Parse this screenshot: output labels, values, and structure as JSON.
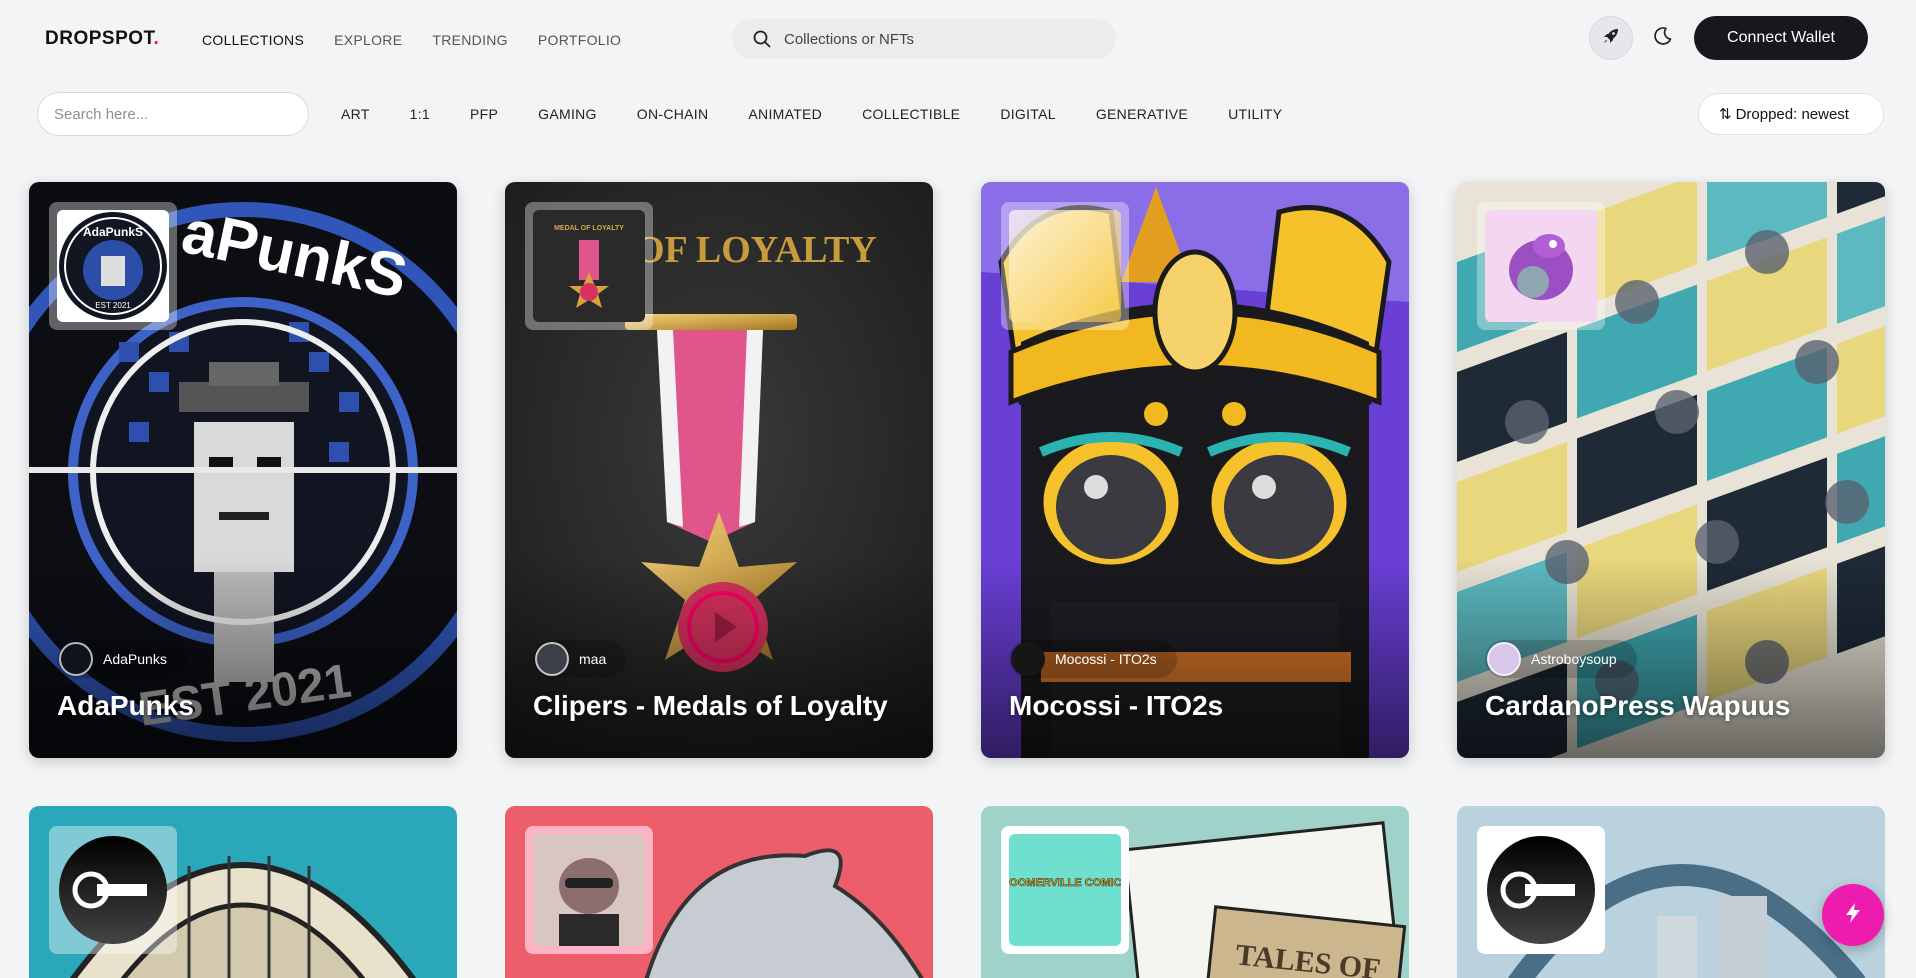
{
  "header": {
    "logo": "DROPSPOT",
    "logo_dot": ".",
    "nav": [
      "COLLECTIONS",
      "EXPLORE",
      "TRENDING",
      "PORTFOLIO"
    ],
    "search_placeholder": "Collections or NFTs",
    "connect_label": "Connect Wallet"
  },
  "filters": {
    "search_placeholder": "Search here...",
    "tags": [
      "ART",
      "1:1",
      "PFP",
      "GAMING",
      "ON-CHAIN",
      "ANIMATED",
      "COLLECTIBLE",
      "DIGITAL",
      "GENERATIVE",
      "UTILITY"
    ],
    "sort_label": "Dropped: newest"
  },
  "cards": [
    {
      "creator": "AdaPunks",
      "title": "AdaPunks",
      "thumb_text": "AdaPunkS",
      "thumb_sub": "EST 2021"
    },
    {
      "creator": "maa",
      "title": "Clipers - Medals of Loyalty",
      "thumb_text": "MEDAL OF LOYALTY",
      "banner_text": "OF LOYALTY"
    },
    {
      "creator": "Mocossi - ITO2s",
      "title": "Mocossi - ITO2s"
    },
    {
      "creator": "Astroboysoup",
      "title": "CardanoPress Wapuus"
    }
  ],
  "row2": [
    {
      "thumb": "key-logo"
    },
    {
      "thumb": "pig-avatar"
    },
    {
      "thumb_text": "BOOMERVILLE COMICS",
      "art_text": "TALES OF"
    },
    {
      "thumb": "key-logo"
    }
  ],
  "colors": {
    "accent": "#e11d48",
    "fab": "#ee1cae",
    "connect_bg": "#16181d"
  }
}
